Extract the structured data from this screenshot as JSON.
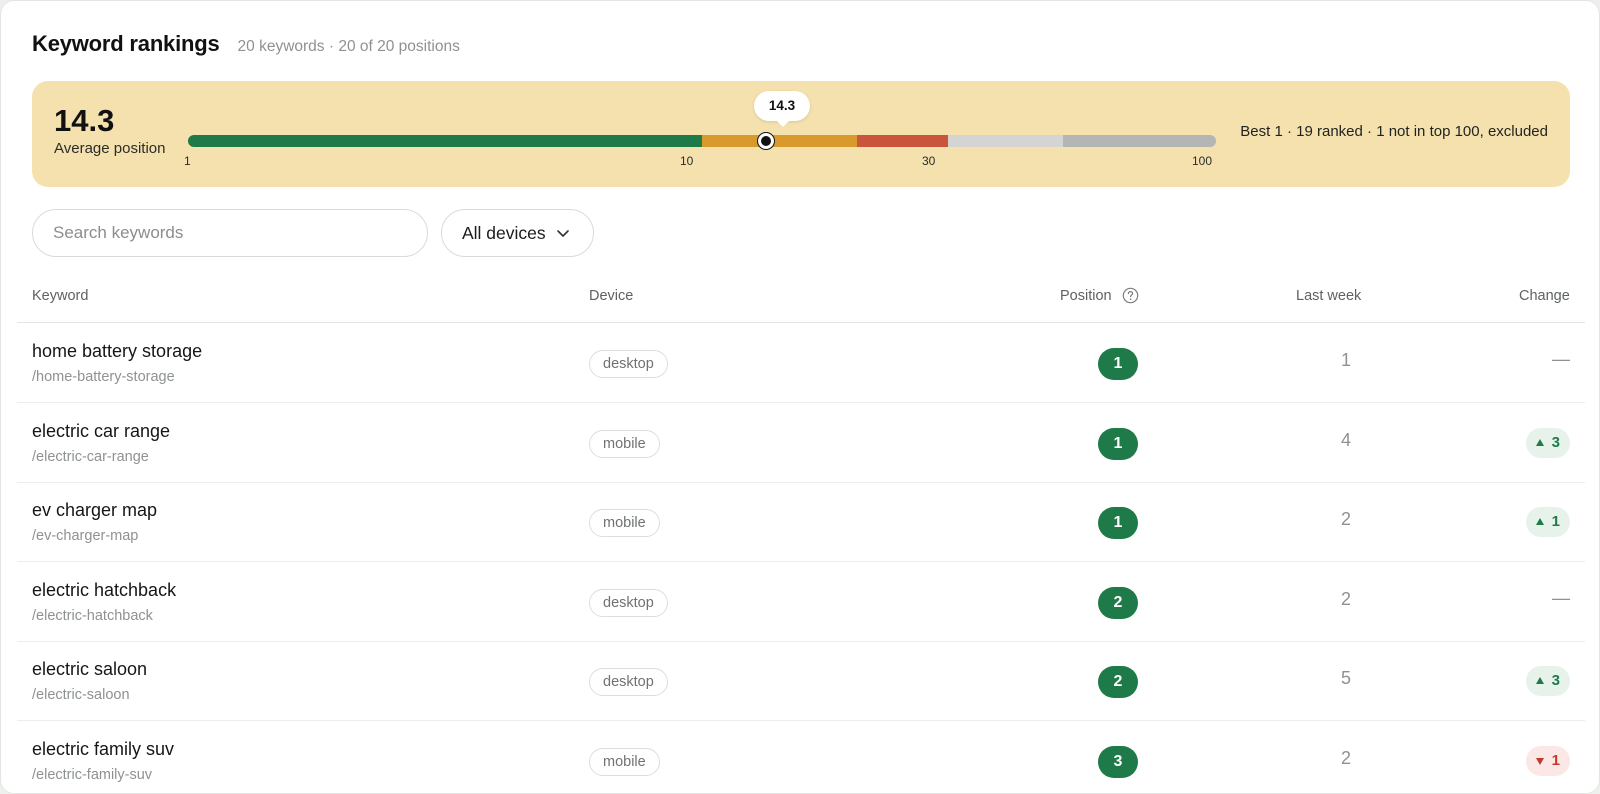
{
  "header": {
    "title": "Keyword rankings",
    "subtitle": "20 keywords · 20 of 20 positions"
  },
  "average": {
    "value": "14.3",
    "label": "Average position",
    "tooltip": "14.3",
    "scale_ticks": [
      "1",
      "10",
      "30",
      "100"
    ],
    "summary": "Best 1 · 19 ranked · 1 not in top 100, excluded",
    "colors": {
      "panel": "#f5e1ae",
      "top10": "#1e7a48",
      "mid": "#d89a2c",
      "low": "#c9553c",
      "rest_light": "#d4d4d2",
      "rest_dark": "#b4b6b4"
    }
  },
  "filters": {
    "search_placeholder": "Search keywords",
    "device_value": "All devices",
    "device_icon": "chevron-down-icon"
  },
  "table": {
    "columns": {
      "keyword": "Keyword",
      "device": "Device",
      "position": "Position",
      "last_week": "Last week",
      "change": "Change"
    },
    "position_help_icon": "question-circle-icon",
    "rows": [
      {
        "keyword": "home battery storage",
        "path": "/home-battery-storage",
        "device": "desktop",
        "position": "1",
        "last_week": "1",
        "change_dir": "none",
        "change": "—"
      },
      {
        "keyword": "electric car range",
        "path": "/electric-car-range",
        "device": "mobile",
        "position": "1",
        "last_week": "4",
        "change_dir": "up",
        "change": "3"
      },
      {
        "keyword": "ev charger map",
        "path": "/ev-charger-map",
        "device": "mobile",
        "position": "1",
        "last_week": "2",
        "change_dir": "up",
        "change": "1"
      },
      {
        "keyword": "electric hatchback",
        "path": "/electric-hatchback",
        "device": "desktop",
        "position": "2",
        "last_week": "2",
        "change_dir": "none",
        "change": "—"
      },
      {
        "keyword": "electric saloon",
        "path": "/electric-saloon",
        "device": "desktop",
        "position": "2",
        "last_week": "5",
        "change_dir": "up",
        "change": "3"
      },
      {
        "keyword": "electric family suv",
        "path": "/electric-family-suv",
        "device": "mobile",
        "position": "3",
        "last_week": "2",
        "change_dir": "down",
        "change": "1"
      }
    ]
  }
}
